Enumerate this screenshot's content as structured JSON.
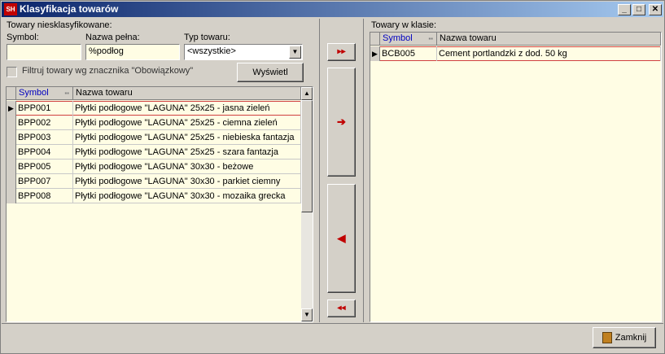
{
  "window": {
    "title": "Klasyfikacja towarów",
    "app_icon_text": "SH"
  },
  "left": {
    "section_label": "Towary niesklasyfikowane:",
    "symbol_label": "Symbol:",
    "symbol_value": "",
    "name_label": "Nazwa pełna:",
    "name_value": "%podłog",
    "type_label": "Typ towaru:",
    "type_value": "<wszystkie>",
    "filter_label": "Filtruj towary wg znacznika \"Obowiązkowy\"",
    "show_button": "Wyświetl",
    "columns": [
      "Symbol",
      "Nazwa towaru"
    ],
    "rows": [
      [
        "BPP001",
        "Płytki podłogowe \"LAGUNA\" 25x25 - jasna zieleń"
      ],
      [
        "BPP002",
        "Płytki podłogowe \"LAGUNA\" 25x25 - ciemna zieleń"
      ],
      [
        "BPP003",
        "Płytki podłogowe \"LAGUNA\" 25x25 - niebieska fantazja"
      ],
      [
        "BPP004",
        "Płytki podłogowe \"LAGUNA\" 25x25 - szara fantazja"
      ],
      [
        "BPP005",
        "Płytki podłogowe \"LAGUNA\" 30x30 - beżowe"
      ],
      [
        "BPP007",
        "Płytki podłogowe \"LAGUNA\" 30x30 - parkiet ciemny"
      ],
      [
        "BPP008",
        "Płytki podłogowe \"LAGUNA\" 30x30 - mozaika grecka"
      ]
    ]
  },
  "right": {
    "section_label": "Towary w klasie:",
    "columns": [
      "Symbol",
      "Nazwa towaru"
    ],
    "rows": [
      [
        "BCB005",
        "Cement portlandzki z dod. 50 kg"
      ]
    ]
  },
  "middle": {
    "add_all": "▸▸",
    "add_one": "➔",
    "remove_one": "◀",
    "remove_all": "◂◂"
  },
  "footer": {
    "close_button": "Zamknij"
  },
  "colors": {
    "grid_bg": "#fffde4",
    "selection_outline": "#d04040",
    "title_start": "#0a246a",
    "title_end": "#a6caf0"
  }
}
